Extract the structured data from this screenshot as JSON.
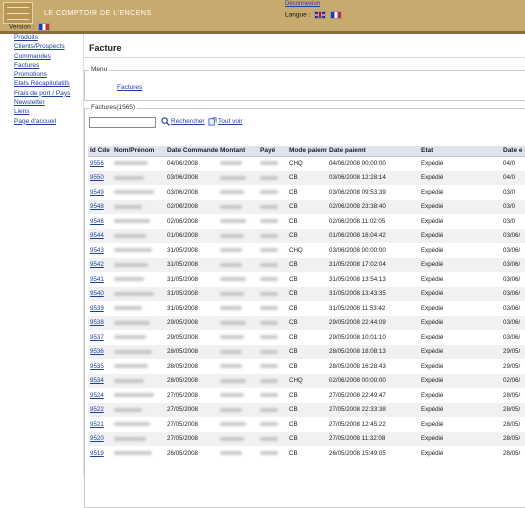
{
  "header": {
    "site_title": "LE COMPTOIR DE L'ENCENS",
    "logout_label": "Déconnexion",
    "lang_label": "Langue :",
    "colors": {
      "bar": "#c8aa6e",
      "stripe": "#8a6d3c",
      "link": "#1c3fa0"
    }
  },
  "sidebar": {
    "version_label": "Version :",
    "items": [
      {
        "label": "Produits"
      },
      {
        "label": "Clients/Prospects"
      },
      {
        "label": "Commandes"
      },
      {
        "label": "Factures"
      },
      {
        "label": "Promotions"
      },
      {
        "label": "Etats Récapitulatifs"
      },
      {
        "label": "Frais de port / Pays"
      },
      {
        "label": "Newsletter"
      },
      {
        "label": "Liens"
      },
      {
        "label": "Page d'accueil"
      }
    ]
  },
  "main": {
    "title": "Facture",
    "menu_legend": "Menu",
    "menu_link": "Factures",
    "list_legend": "Factures(1565)",
    "search_value": "",
    "search_label": "Rechercher",
    "reset_label": "Tout voir",
    "columns": [
      "Id Cde",
      "Nom/Prénom",
      "Date Commande",
      "Montant",
      "Payé",
      "Mode paiemt",
      "Date paiemt",
      "Etat",
      "Date e"
    ],
    "rows": [
      {
        "id": "9556",
        "date_cmd": "04/06/2008",
        "mode": "CHQ",
        "date_paie": "04/06/2008 00:00:00",
        "etat": "Expédié",
        "date_e": "04/0"
      },
      {
        "id": "9550",
        "date_cmd": "03/06/2008",
        "mode": "CB",
        "date_paie": "03/06/2008 12:28:14",
        "etat": "Expédié",
        "date_e": "04/0"
      },
      {
        "id": "9549",
        "date_cmd": "03/06/2008",
        "mode": "CB",
        "date_paie": "03/06/2008 09:53:39",
        "etat": "Expédié",
        "date_e": "03/0"
      },
      {
        "id": "9548",
        "date_cmd": "02/06/2008",
        "mode": "CB",
        "date_paie": "02/06/2008 23:38:40",
        "etat": "Expédié",
        "date_e": "03/0"
      },
      {
        "id": "9546",
        "date_cmd": "02/06/2008",
        "mode": "CB",
        "date_paie": "02/06/2008 11:02:05",
        "etat": "Expédié",
        "date_e": "03/0"
      },
      {
        "id": "9544",
        "date_cmd": "01/06/2008",
        "mode": "CB",
        "date_paie": "01/06/2008 16:04:42",
        "etat": "Expédié",
        "date_e": "03/06/"
      },
      {
        "id": "9543",
        "date_cmd": "31/05/2008",
        "mode": "CHQ",
        "date_paie": "03/06/2008 00:00:00",
        "etat": "Expédié",
        "date_e": "03/06/"
      },
      {
        "id": "9542",
        "date_cmd": "31/05/2008",
        "mode": "CB",
        "date_paie": "31/05/2008 17:02:04",
        "etat": "Expédié",
        "date_e": "03/06/"
      },
      {
        "id": "9541",
        "date_cmd": "31/05/2008",
        "mode": "CB",
        "date_paie": "31/05/2008 13:54:13",
        "etat": "Expédié",
        "date_e": "03/06/"
      },
      {
        "id": "9540",
        "date_cmd": "31/05/2008",
        "mode": "CB",
        "date_paie": "31/05/2008 13:43:35",
        "etat": "Expédié",
        "date_e": "03/06/"
      },
      {
        "id": "9539",
        "date_cmd": "31/05/2008",
        "mode": "CB",
        "date_paie": "31/05/2008 11:53:42",
        "etat": "Expédié",
        "date_e": "03/06/"
      },
      {
        "id": "9538",
        "date_cmd": "29/05/2008",
        "mode": "CB",
        "date_paie": "29/05/2008 22:44:09",
        "etat": "Expédié",
        "date_e": "03/06/"
      },
      {
        "id": "9537",
        "date_cmd": "29/05/2008",
        "mode": "CB",
        "date_paie": "29/05/2008 10:01:10",
        "etat": "Expédié",
        "date_e": "03/06/"
      },
      {
        "id": "9536",
        "date_cmd": "28/05/2008",
        "mode": "CB",
        "date_paie": "28/05/2008 18:08:13",
        "etat": "Expédié",
        "date_e": "29/05/"
      },
      {
        "id": "9535",
        "date_cmd": "28/05/2008",
        "mode": "CB",
        "date_paie": "28/05/2008 16:28:43",
        "etat": "Expédié",
        "date_e": "29/05/"
      },
      {
        "id": "9534",
        "date_cmd": "28/05/2008",
        "mode": "CHQ",
        "date_paie": "02/06/2008 00:00:00",
        "etat": "Expédié",
        "date_e": "02/06/"
      },
      {
        "id": "9524",
        "date_cmd": "27/05/2008",
        "mode": "CB",
        "date_paie": "27/05/2008 22:49:47",
        "etat": "Expédié",
        "date_e": "28/05/"
      },
      {
        "id": "9522",
        "date_cmd": "27/05/2008",
        "mode": "CB",
        "date_paie": "27/05/2008 22:33:38",
        "etat": "Expédié",
        "date_e": "28/05/"
      },
      {
        "id": "9521",
        "date_cmd": "27/05/2008",
        "mode": "CB",
        "date_paie": "27/05/2008 12:45:22",
        "etat": "Expédié",
        "date_e": "28/05/"
      },
      {
        "id": "9520",
        "date_cmd": "27/05/2008",
        "mode": "CB",
        "date_paie": "27/05/2008 11:32:08",
        "etat": "Expédié",
        "date_e": "28/05/"
      },
      {
        "id": "9519",
        "date_cmd": "26/05/2008",
        "mode": "CB",
        "date_paie": "26/05/2008 15:49:05",
        "etat": "Expédié",
        "date_e": "28/05/"
      }
    ]
  }
}
